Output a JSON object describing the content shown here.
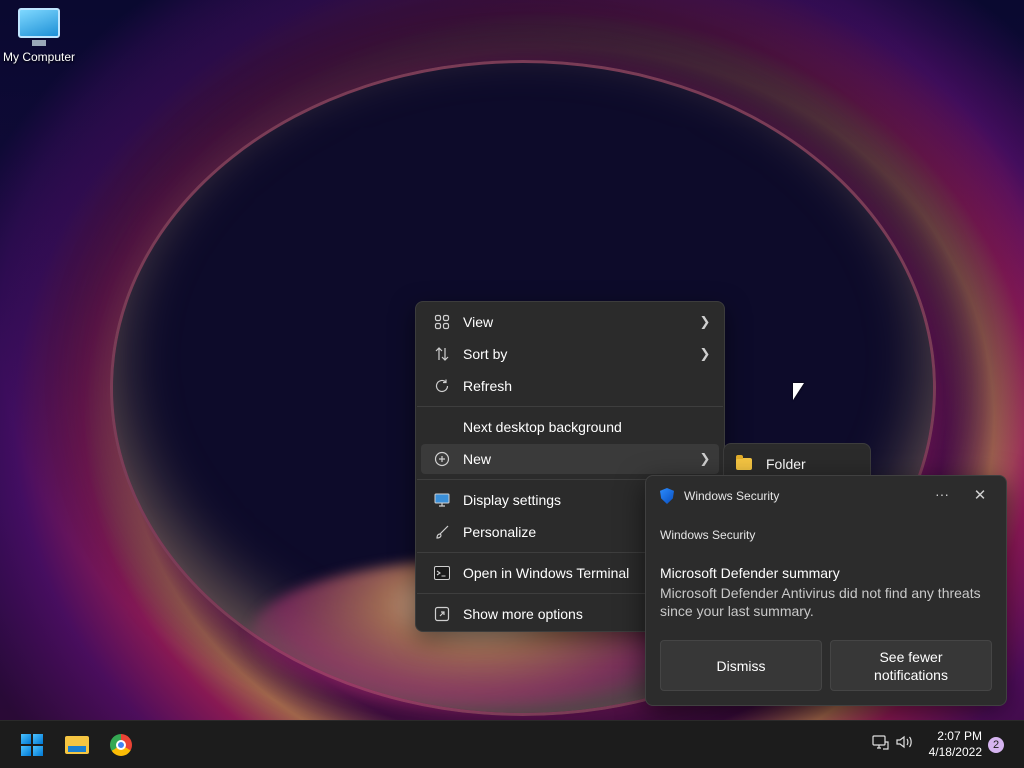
{
  "desktop": {
    "icons": [
      {
        "label": "My Computer",
        "icon": "monitor-icon"
      }
    ]
  },
  "context_menu": {
    "items": [
      {
        "label": "View",
        "icon": "grid-icon",
        "has_submenu": true
      },
      {
        "label": "Sort by",
        "icon": "sort-arrows-icon",
        "has_submenu": true
      },
      {
        "label": "Refresh",
        "icon": "refresh-icon",
        "has_submenu": false
      },
      {
        "label": "Next desktop background",
        "icon": "",
        "has_submenu": false
      },
      {
        "label": "New",
        "icon": "plus-circle-icon",
        "has_submenu": true
      },
      {
        "label": "Display settings",
        "icon": "display-icon",
        "has_submenu": false
      },
      {
        "label": "Personalize",
        "icon": "brush-icon",
        "has_submenu": false
      },
      {
        "label": "Open in Windows Terminal",
        "icon": "terminal-icon",
        "has_submenu": false
      },
      {
        "label": "Show more options",
        "icon": "expand-icon",
        "has_submenu": false
      }
    ],
    "submenu_new": {
      "items": [
        {
          "label": "Folder",
          "icon": "folder-icon"
        }
      ]
    }
  },
  "notification": {
    "app_name": "Windows Security",
    "app_label": "Windows Security",
    "title": "Microsoft Defender summary",
    "body": "Microsoft Defender Antivirus did not find any threats since your last summary.",
    "more_label": "···",
    "close_label": "✕",
    "buttons": {
      "dismiss": "Dismiss",
      "fewer_line1": "See fewer",
      "fewer_line2": "notifications"
    }
  },
  "taskbar": {
    "apps": [
      {
        "name": "start-button",
        "icon": "windows-logo-icon"
      },
      {
        "name": "file-explorer-button",
        "icon": "file-explorer-icon"
      },
      {
        "name": "chrome-button",
        "icon": "chrome-icon"
      }
    ],
    "tray": {
      "time": "2:07 PM",
      "date": "4/18/2022",
      "notification_count": "2"
    }
  },
  "colors": {
    "menu_bg": "#2b2b2b",
    "toast_bg": "#2c2c2c",
    "taskbar_bg": "#1c1c1c",
    "accent": "#0078d4"
  }
}
